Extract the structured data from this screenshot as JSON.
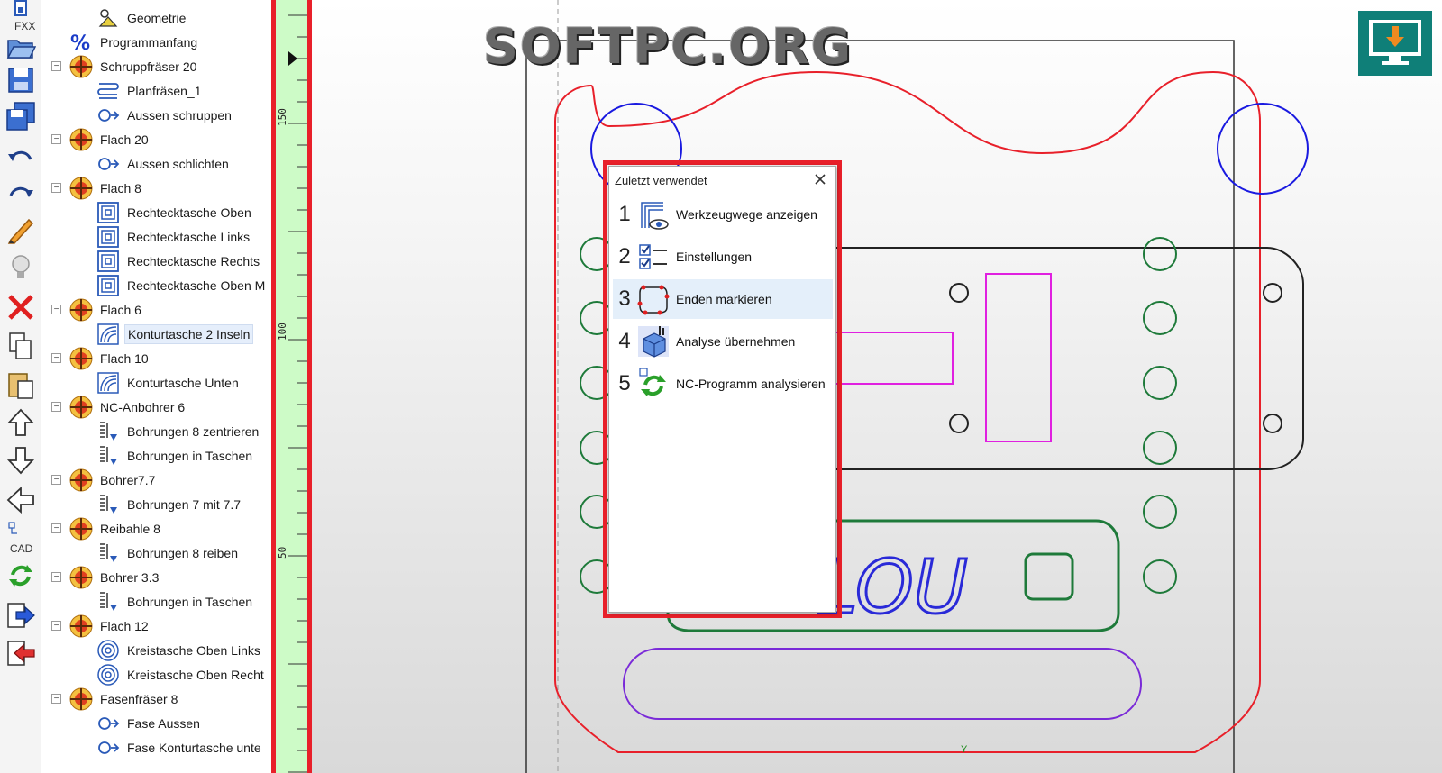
{
  "toolbar": {
    "fxx_label": "FXX",
    "cad_label": "CAD",
    "buttons": [
      "fxx-icon",
      "open-icon",
      "save-icon",
      "save-as-icon",
      "undo-icon",
      "redo-icon",
      "pencil-icon",
      "lightbulb-icon",
      "delete-icon",
      "copy-icon",
      "paste-icon",
      "move-up-icon",
      "move-down-icon",
      "back-icon",
      "cad-icon",
      "refresh-icon",
      "export-icon",
      "import-icon"
    ]
  },
  "tree": {
    "items": [
      {
        "label": "Geometrie",
        "level": 1,
        "icon": "geometry-icon"
      },
      {
        "label": "Programmanfang",
        "level": 0,
        "icon": "percent-icon"
      },
      {
        "label": "Schruppfräser 20",
        "level": 0,
        "icon": "tool-icon",
        "expander": "−"
      },
      {
        "label": "Planfräsen_1",
        "level": 1,
        "icon": "facing-icon"
      },
      {
        "label": "Aussen schruppen",
        "level": 1,
        "icon": "contour-icon"
      },
      {
        "label": "Flach 20",
        "level": 0,
        "icon": "tool-icon",
        "expander": "−"
      },
      {
        "label": "Aussen schlichten",
        "level": 1,
        "icon": "contour-icon"
      },
      {
        "label": "Flach 8",
        "level": 0,
        "icon": "tool-icon",
        "expander": "−"
      },
      {
        "label": "Rechtecktasche Oben",
        "level": 1,
        "icon": "pocket-icon"
      },
      {
        "label": "Rechtecktasche Links",
        "level": 1,
        "icon": "pocket-icon"
      },
      {
        "label": "Rechtecktasche Rechts",
        "level": 1,
        "icon": "pocket-icon"
      },
      {
        "label": "Rechtecktasche Oben M",
        "level": 1,
        "icon": "pocket-icon"
      },
      {
        "label": "Flach 6",
        "level": 0,
        "icon": "tool-icon",
        "expander": "−"
      },
      {
        "label": "Konturtasche 2 Inseln",
        "level": 1,
        "icon": "contour-pocket-icon",
        "selected": true
      },
      {
        "label": "Flach 10",
        "level": 0,
        "icon": "tool-icon",
        "expander": "−"
      },
      {
        "label": "Konturtasche Unten",
        "level": 1,
        "icon": "contour-pocket-icon"
      },
      {
        "label": "NC-Anbohrer 6",
        "level": 0,
        "icon": "tool-icon",
        "expander": "−"
      },
      {
        "label": "Bohrungen 8 zentrieren",
        "level": 1,
        "icon": "drill-icon"
      },
      {
        "label": "Bohrungen in Taschen",
        "level": 1,
        "icon": "drill-icon"
      },
      {
        "label": "Bohrer7.7",
        "level": 0,
        "icon": "tool-icon",
        "expander": "−"
      },
      {
        "label": "Bohrungen 7 mit 7.7",
        "level": 1,
        "icon": "drill-icon"
      },
      {
        "label": "Reibahle 8",
        "level": 0,
        "icon": "tool-icon",
        "expander": "−"
      },
      {
        "label": "Bohrungen 8 reiben",
        "level": 1,
        "icon": "drill-icon"
      },
      {
        "label": "Bohrer 3.3",
        "level": 0,
        "icon": "tool-icon",
        "expander": "−"
      },
      {
        "label": "Bohrungen in Taschen",
        "level": 1,
        "icon": "drill-icon"
      },
      {
        "label": "Flach 12",
        "level": 0,
        "icon": "tool-icon",
        "expander": "−"
      },
      {
        "label": "Kreistasche Oben Links",
        "level": 1,
        "icon": "circle-pocket-icon"
      },
      {
        "label": "Kreistasche Oben Recht",
        "level": 1,
        "icon": "circle-pocket-icon"
      },
      {
        "label": "Fasenfräser 8",
        "level": 0,
        "icon": "tool-icon",
        "expander": "−"
      },
      {
        "label": "Fase Aussen",
        "level": 1,
        "icon": "contour-icon"
      },
      {
        "label": "Fase Konturtasche unte",
        "level": 1,
        "icon": "contour-icon"
      }
    ]
  },
  "ruler": {
    "labels": [
      "150",
      "100",
      "50"
    ]
  },
  "canvas": {
    "watermark": "SOFTPC.ORG",
    "engraving_text": "LOU",
    "axis_label": "Y"
  },
  "popup": {
    "title": "Zuletzt verwendet",
    "items": [
      {
        "num": "1",
        "label": "Werkzeugwege anzeigen",
        "icon": "toolpath-view-icon"
      },
      {
        "num": "2",
        "label": "Einstellungen",
        "icon": "settings-checklist-icon"
      },
      {
        "num": "3",
        "label": "Enden markieren",
        "icon": "mark-ends-icon",
        "hover": true
      },
      {
        "num": "4",
        "label": "Analyse übernehmen",
        "icon": "analysis-cube-icon"
      },
      {
        "num": "5",
        "label": "NC-Programm analysieren",
        "icon": "nc-analyze-icon"
      }
    ]
  },
  "colors": {
    "highlight_frame": "#e8202a",
    "ruler_bg": "#cdfbc7",
    "download_bg": "#0f7f78",
    "contour_red": "#e8202a",
    "circle_blue": "#1a1ae0",
    "circle_green": "#1e7a3a",
    "pocket_magenta": "#e020e0",
    "slot_purple": "#7a2ad8",
    "text_blue": "#2a2ad8"
  }
}
